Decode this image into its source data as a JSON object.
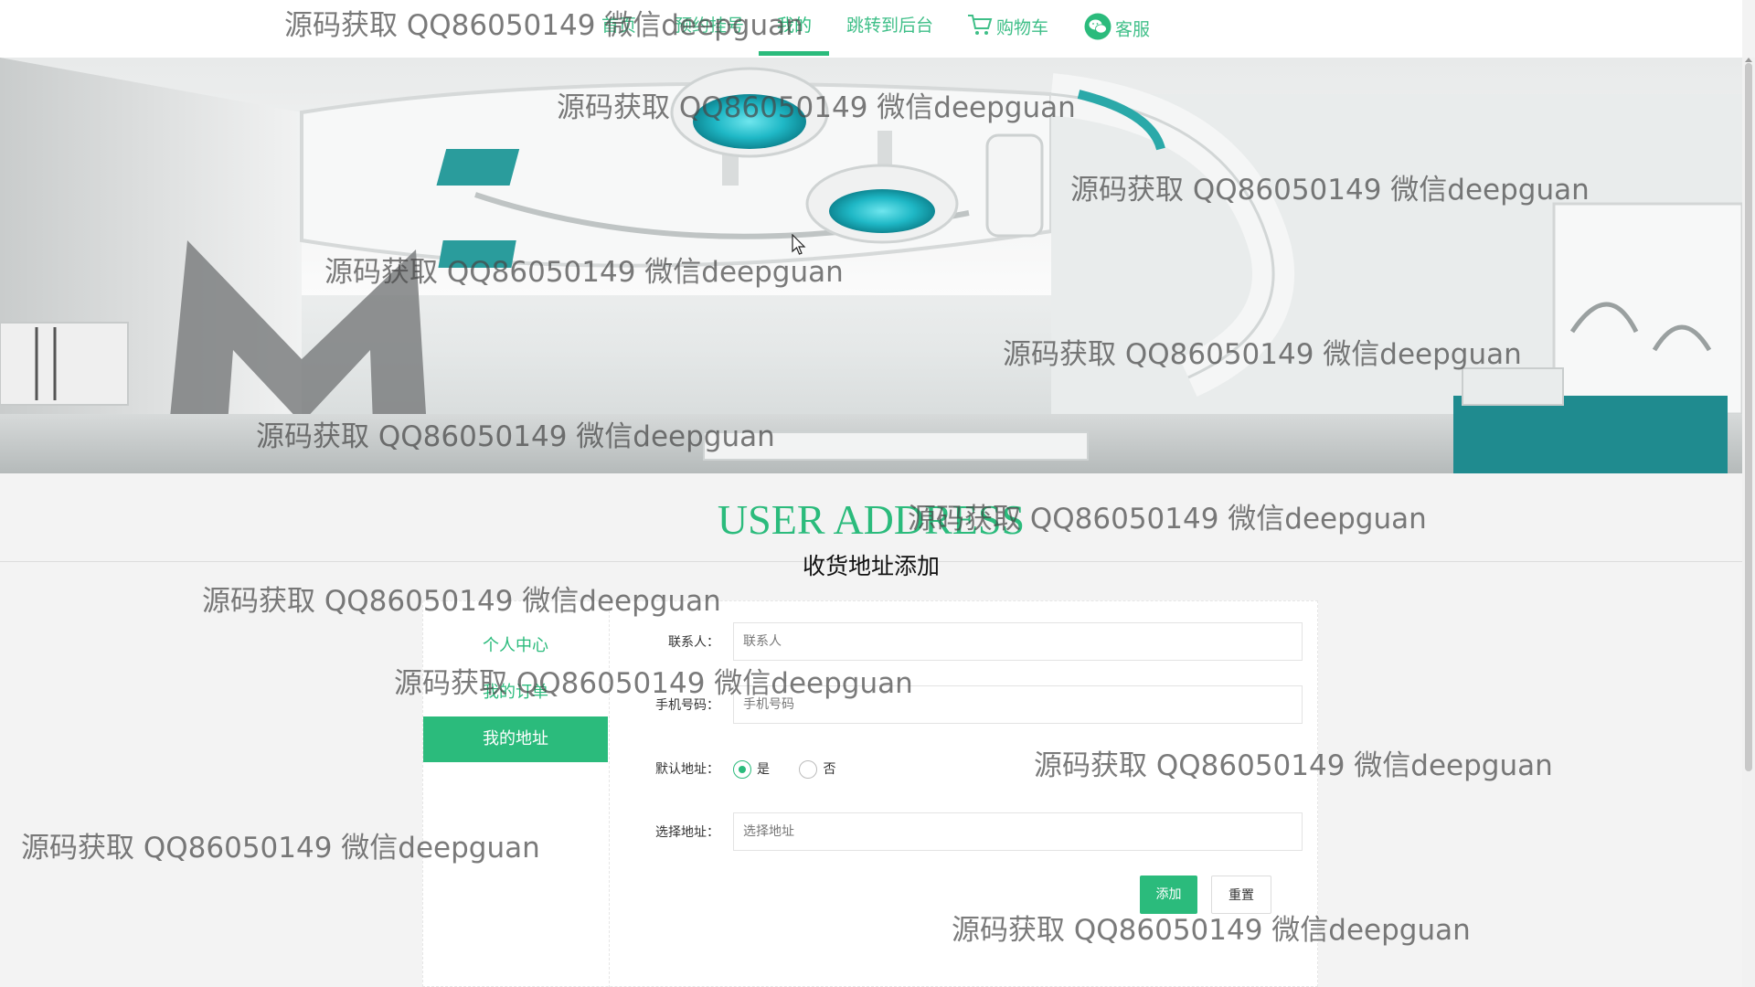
{
  "nav": {
    "items": [
      {
        "label": "首页"
      },
      {
        "label": "预约挂号"
      },
      {
        "label": "我的"
      },
      {
        "label": "跳转到后台"
      },
      {
        "label": "购物车"
      },
      {
        "label": "客服"
      }
    ],
    "active_index": 2
  },
  "section": {
    "title": "USER ADDRESS",
    "subtitle": "收货地址添加"
  },
  "sidebar": {
    "items": [
      {
        "label": "个人中心"
      },
      {
        "label": "我的订单"
      },
      {
        "label": "我的地址"
      }
    ],
    "active_index": 2
  },
  "form": {
    "contact": {
      "label": "联系人：",
      "placeholder": "联系人",
      "value": ""
    },
    "phone": {
      "label": "手机号码：",
      "placeholder": "手机号码",
      "value": ""
    },
    "default": {
      "label": "默认地址：",
      "options": [
        "是",
        "否"
      ],
      "selected": "是"
    },
    "address": {
      "label": "选择地址：",
      "placeholder": "选择地址",
      "value": ""
    },
    "add_label": "添加",
    "reset_label": "重置"
  },
  "watermark": {
    "text": "源码获取 QQ86050149 微信deepguan"
  },
  "colors": {
    "accent": "#2bbb7c"
  },
  "icons": {
    "cart": "shopping-cart-icon",
    "wechat": "wechat-icon"
  }
}
